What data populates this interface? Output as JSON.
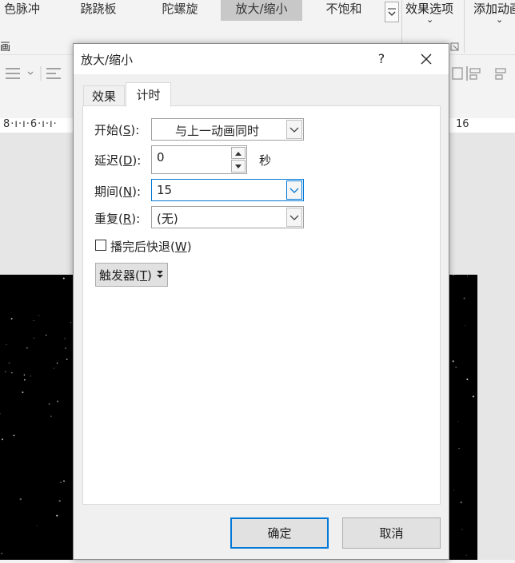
{
  "ribbon": {
    "gallery": [
      "色脉冲",
      "跷跷板",
      "陀螺旋",
      "放大/缩小",
      "不饱和"
    ],
    "selected_index": 3,
    "effect_options": "效果选项",
    "add_animation": "添加动画",
    "left_fragment": "画"
  },
  "ruler": {
    "left_marks": "8·ı·ı·6·ı·ı·",
    "right_mark": "16"
  },
  "dialog": {
    "title": "放大/缩小",
    "help": "?",
    "close": "✕",
    "tabs": {
      "effect": "效果",
      "timing": "计时"
    },
    "start": {
      "label": "开始(",
      "key": "S",
      "end": "):",
      "value": "与上一动画同时"
    },
    "delay": {
      "label": "延迟(",
      "key": "D",
      "end": "):",
      "value": "0",
      "unit": "秒"
    },
    "duration": {
      "label": "期间(",
      "key": "N",
      "end": "):",
      "value": "15"
    },
    "repeat": {
      "label": "重复(",
      "key": "R",
      "end": "):",
      "value": "(无)"
    },
    "rewind": {
      "label": "播完后快退(",
      "key": "W",
      "end": ")",
      "checked": false
    },
    "triggers": {
      "label": "触发器(",
      "key": "T",
      "end": ")"
    },
    "ok": "确定",
    "cancel": "取消"
  }
}
